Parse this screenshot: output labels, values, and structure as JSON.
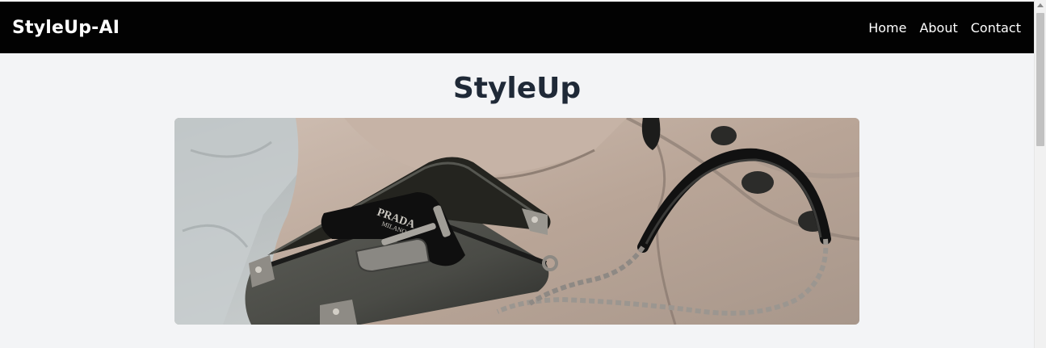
{
  "brand": "StyleUp-AI",
  "nav": {
    "items": [
      "Home",
      "About",
      "Contact"
    ]
  },
  "main": {
    "title": "StyleUp"
  },
  "hero_image": {
    "bag_label_line1": "PRADA",
    "bag_label_line2": "MILANO"
  },
  "colors": {
    "navbar": "#020202",
    "background": "#f3f4f6",
    "title": "#1f2937"
  }
}
